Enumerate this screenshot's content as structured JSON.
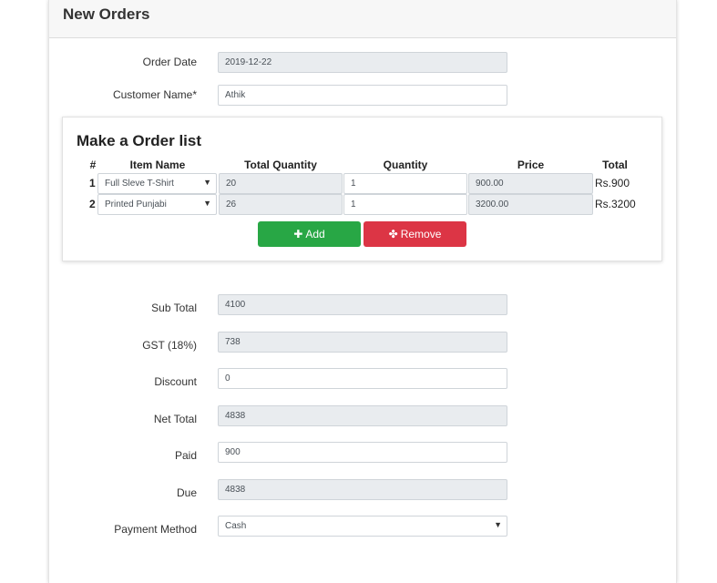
{
  "header": {
    "title": "New Orders"
  },
  "form": {
    "order_date": {
      "label": "Order Date",
      "value": "2019-12-22"
    },
    "customer_name": {
      "label": "Customer Name*",
      "value": "Athik"
    },
    "sub_total": {
      "label": "Sub Total",
      "value": "4100"
    },
    "gst": {
      "label": "GST (18%)",
      "value": "738"
    },
    "discount": {
      "label": "Discount",
      "value": "0"
    },
    "net_total": {
      "label": "Net Total",
      "value": "4838"
    },
    "paid": {
      "label": "Paid",
      "value": "900"
    },
    "due": {
      "label": "Due",
      "value": "4838"
    },
    "payment_method": {
      "label": "Payment Method",
      "value": "Cash"
    }
  },
  "order_list": {
    "title": "Make a Order list",
    "headers": {
      "num": "#",
      "item_name": "Item Name",
      "total_quantity": "Total Quantity",
      "quantity": "Quantity",
      "price": "Price",
      "total": "Total"
    },
    "rows": [
      {
        "num": "1",
        "item_name": "Full Sleve T-Shirt",
        "total_quantity": "20",
        "quantity": "1",
        "price": "900.00",
        "total": "Rs.900"
      },
      {
        "num": "2",
        "item_name": "Printed Punjabi",
        "total_quantity": "26",
        "quantity": "1",
        "price": "3200.00",
        "total": "Rs.3200"
      }
    ],
    "add_label": "Add",
    "remove_label": "Remove"
  },
  "icons": {
    "add": "plus-icon",
    "remove": "crosshair-icon",
    "select": "caret-down-icon"
  },
  "colors": {
    "add_button": "#28a745",
    "remove_button": "#dc3545",
    "readonly_field": "#e9ecef"
  }
}
